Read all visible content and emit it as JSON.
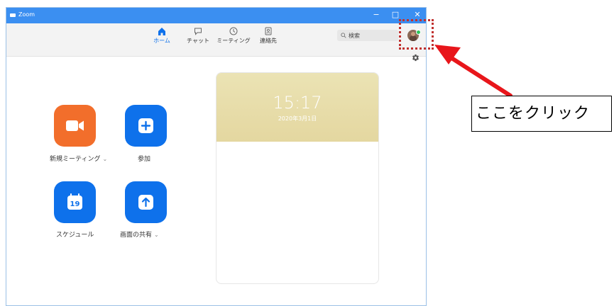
{
  "window": {
    "title": "Zoom",
    "controls": {
      "minimize": "−",
      "maximize": "□",
      "close": "✕"
    }
  },
  "nav_tabs": [
    {
      "label": "ホーム",
      "icon": "home-icon",
      "active": true
    },
    {
      "label": "チャット",
      "icon": "chat-icon",
      "active": false
    },
    {
      "label": "ミーティング",
      "icon": "clock-icon",
      "active": false
    },
    {
      "label": "連絡先",
      "icon": "contacts-icon",
      "active": false
    }
  ],
  "search": {
    "placeholder": "検索",
    "icon": "search-icon"
  },
  "profile": {
    "icon": "avatar",
    "status": "online"
  },
  "actions": [
    {
      "label": "新規ミーティング",
      "icon": "video-camera-icon",
      "color": "#f26e2b",
      "has_dropdown": true
    },
    {
      "label": "参加",
      "icon": "plus-icon",
      "color": "#0e71eb",
      "has_dropdown": false
    },
    {
      "label": "スケジュール",
      "icon": "calendar-icon",
      "color": "#0e71eb",
      "has_dropdown": false
    },
    {
      "label": "画面の共有",
      "icon": "share-screen-icon",
      "color": "#0e71eb",
      "has_dropdown": true
    }
  ],
  "calendar_icon_day": "19",
  "clock": {
    "time": "15:17",
    "date": "2020年3月1日"
  },
  "annotation": {
    "text": "ここをクリック",
    "color": "#e8161b"
  }
}
